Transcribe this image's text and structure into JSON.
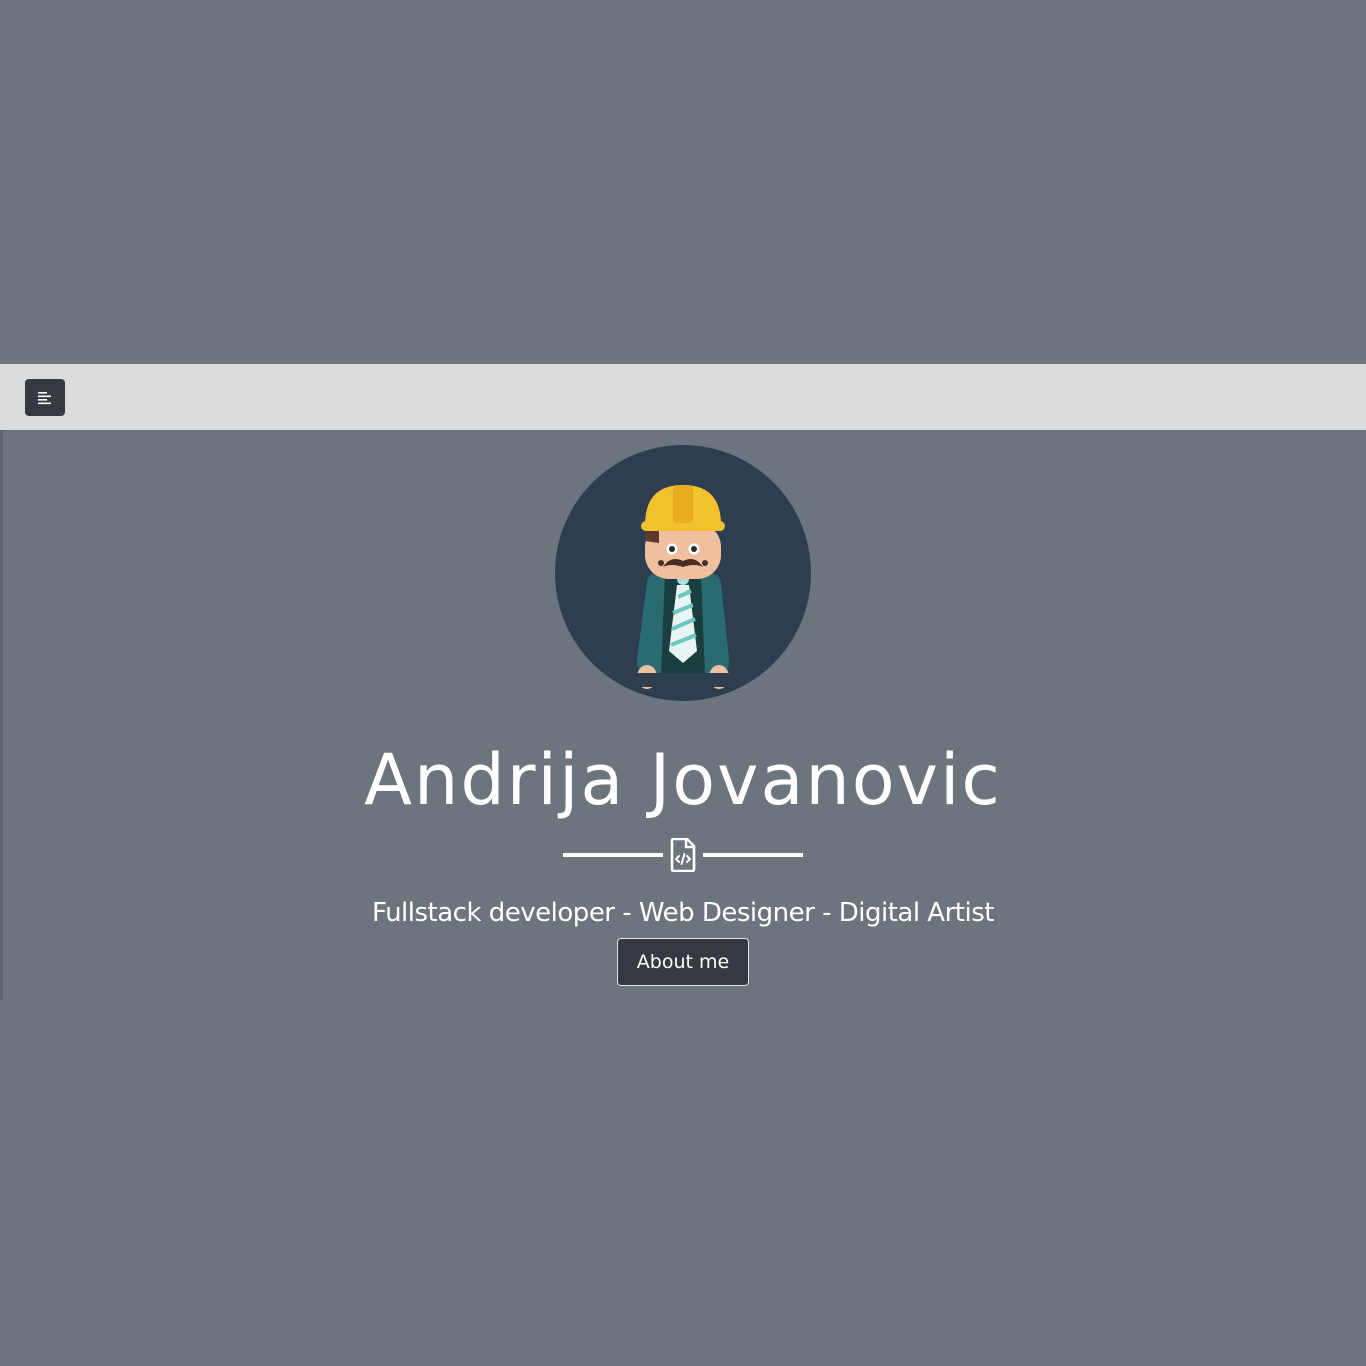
{
  "navbar": {
    "toggle_icon": "menu-lines-icon"
  },
  "hero": {
    "avatar_icon": "builder-avatar-icon",
    "title": "Andrija Jovanovic",
    "divider_icon": "code-file-icon",
    "tagline": "Fullstack developer - Web Designer - Digital Artist",
    "about_button": "About me"
  },
  "colors": {
    "background": "#6c757d",
    "navbar": "#dcdcdc",
    "button": "#343a40",
    "avatar_circle": "#2c3e50",
    "helmet": "#f2c12e",
    "jacket": "#2a6b72",
    "text": "#ffffff"
  }
}
